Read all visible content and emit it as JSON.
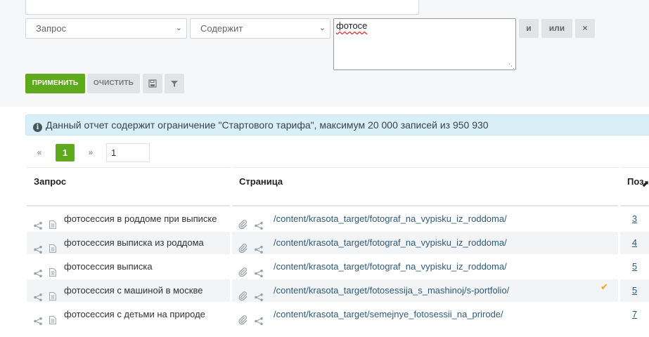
{
  "filters": {
    "field_select": "Запрос",
    "operator_select": "Содержит",
    "value_text": "фотосе",
    "and_label": "и",
    "or_label": "или",
    "remove_label": "×"
  },
  "actions": {
    "apply_label": "ПРИМЕНИТЬ",
    "clear_label": "ОЧИСТИТЬ",
    "save_icon": "floppy-disk-icon",
    "filter_icon": "funnel-icon"
  },
  "alert": {
    "icon": "info-icon",
    "icon_glyph": "i",
    "text": "Данный отчет содержит ограничение \"Стартового тарифа\", максимум 20 000 записей из 950 930"
  },
  "pagination": {
    "prev": "«",
    "current": "1",
    "next": "»",
    "goto_value": "1"
  },
  "table": {
    "columns": {
      "query": "Запрос",
      "page": "Страница",
      "position": "Поз."
    },
    "rows": [
      {
        "query": "фотосессия в роддоме при выписке",
        "url": "/content/krasota_target/fotograf_na_vypisku_iz_roddoma/",
        "position": "3",
        "checked": false
      },
      {
        "query": "фотосессия выписка из роддома",
        "url": "/content/krasota_target/fotograf_na_vypisku_iz_roddoma/",
        "position": "4",
        "checked": false
      },
      {
        "query": "фотосессия выписка",
        "url": "/content/krasota_target/fotograf_na_vypisku_iz_roddoma/",
        "position": "5",
        "checked": false
      },
      {
        "query": "фотосессия с машиной в москве",
        "url": "/content/krasota_target/fotosessija_s_mashinoj/s-portfolio/",
        "position": "5",
        "checked": true,
        "check_glyph": "✔"
      },
      {
        "query": "фотосессия с детьми на природе",
        "url": "/content/krasota_target/semejnye_fotosessii_na_prirode/",
        "position": "7",
        "checked": false
      }
    ]
  },
  "colors": {
    "accent_green": "#5faa1c",
    "alert_bg": "#d9eff7",
    "link": "#2e5b7c",
    "check": "#f0a020"
  }
}
